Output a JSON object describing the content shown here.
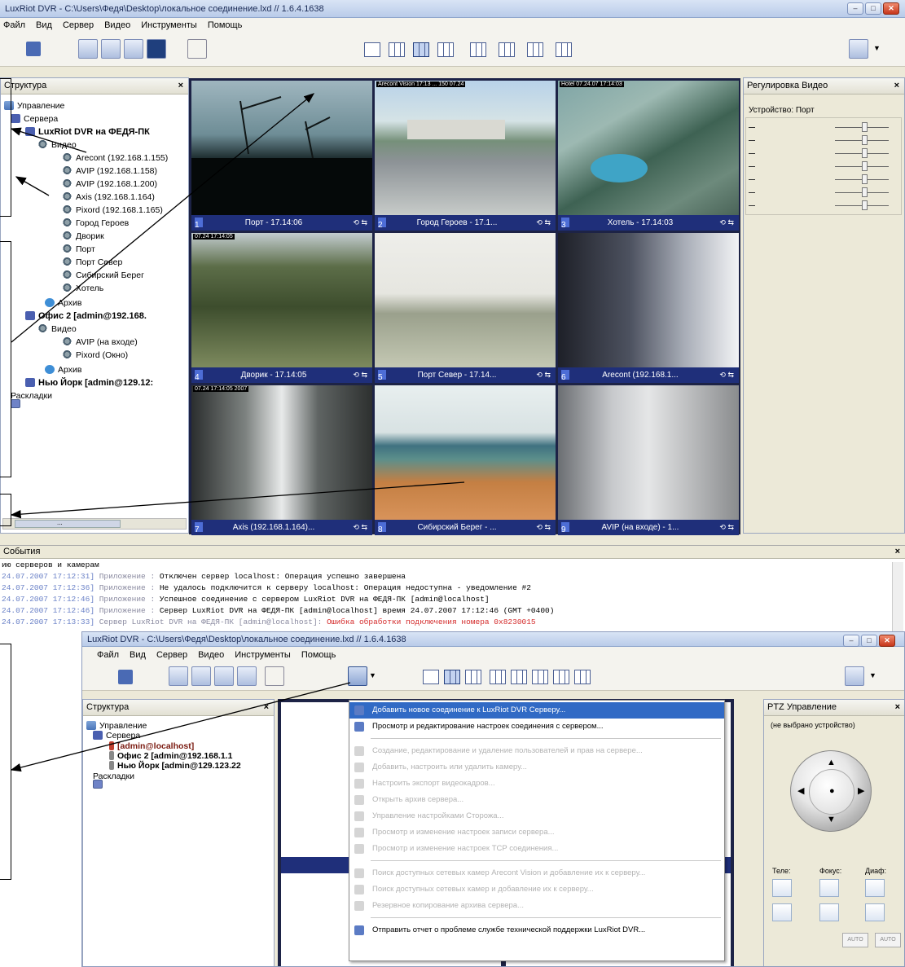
{
  "win1": {
    "title": "LuxRiot DVR - C:\\Users\\Федя\\Desktop\\локальное соединение.lxd // 1.6.4.1638",
    "menu": [
      "Файл",
      "Вид",
      "Сервер",
      "Видео",
      "Инструменты",
      "Помощь"
    ],
    "structure_panel": {
      "title": "Структура",
      "tree": [
        "Управление",
        "Сервера",
        "LuxRiot DVR на ФЕДЯ-ПК",
        "Видео",
        "Arecont (192.168.1.155)",
        "AVIP (192.168.1.158)",
        "AVIP (192.168.1.200)",
        "Axis (192.168.1.164)",
        "Pixord (192.168.1.165)",
        "Город Героев",
        "Дворик",
        "Порт",
        "Порт Север",
        "Сибирский Берег",
        "Хотель",
        "Архив",
        "Офис 2 [admin@192.168.",
        "Видео",
        "AVIP (на входе)",
        "Pixord (Окно)",
        "Архив",
        "Нью Йорк [admin@129.12:",
        "Раскладки"
      ],
      "scroll_label": "..."
    },
    "cameras": [
      {
        "num": "1",
        "label": "Порт - 17.14:06",
        "osd": ""
      },
      {
        "num": "2",
        "label": "Город Героев - 17.1...",
        "osd": "Arecont Vision 17:13 ... 150 07.24"
      },
      {
        "num": "3",
        "label": "Хотель - 17.14:03",
        "osd": "Hotel 07.24.07 17:14:03"
      },
      {
        "num": "4",
        "label": "Дворик - 17.14:05",
        "osd": "07.24 17:14:05"
      },
      {
        "num": "5",
        "label": "Порт Север - 17.14...",
        "osd": ""
      },
      {
        "num": "6",
        "label": "Arecont (192.168.1...",
        "osd": ""
      },
      {
        "num": "7",
        "label": "Axis (192.168.1.164)...",
        "osd": "07.24 17:14:05 2007"
      },
      {
        "num": "8",
        "label": "Сибирский Берег - ...",
        "osd": ""
      },
      {
        "num": "9",
        "label": "AVIP (на входе) - 1...",
        "osd": ""
      }
    ],
    "video_adjust": {
      "title": "Регулировка Видео",
      "device_label": "Устройство: Порт",
      "levels": [
        0.55,
        0.55,
        0.55,
        0.55,
        0.55,
        0.55,
        0.55
      ]
    },
    "events": {
      "title": "События",
      "lines": [
        {
          "date": "",
          "cat": "",
          "text": "ию серверов и камерам"
        },
        {
          "date": "24.07.2007 17:12:31]",
          "cat": " Приложение : ",
          "text": "Отключен сервер localhost: Операция успешно завершена"
        },
        {
          "date": "24.07.2007 17:12:36]",
          "cat": " Приложение : ",
          "text": "Не удалось подключится к серверу localhost: Операция недоступна - уведомление #2"
        },
        {
          "date": "24.07.2007 17:12:46]",
          "cat": " Приложение : ",
          "text": "Успешное соединение с сервером LuxRiot DVR на ФЕДЯ-ПК [admin@localhost]"
        },
        {
          "date": "24.07.2007 17:12:46]",
          "cat": " Приложение : ",
          "text": "Сервер LuxRiot DVR на ФЕДЯ-ПК [admin@localhost] время 24.07.2007 17:12:46 (GMT +0400)"
        },
        {
          "date": "24.07.2007 17:13:33]",
          "cat": " Сервер LuxRiot DVR на ФЕДЯ-ПК [admin@localhost]: ",
          "text": "Ошибка обработки подключения номера 0x8230015"
        }
      ]
    }
  },
  "win2": {
    "title": "LuxRiot DVR - C:\\Users\\Федя\\Desktop\\локальное соединение.lxd // 1.6.4.1638",
    "menu": [
      "Файл",
      "Вид",
      "Сервер",
      "Видео",
      "Инструменты",
      "Помощь"
    ],
    "structure_panel": {
      "title": "Структура",
      "tree": [
        "Управление",
        "Сервера",
        "[admin@localhost]",
        "Офис 2 [admin@192.168.1.1",
        "Нью Йорк [admin@129.123.22",
        "Раскладки"
      ]
    },
    "server_menu": [
      {
        "label": "Добавить новое соединение к LuxRiot DVR Серверу...",
        "enabled": true,
        "highlight": true
      },
      {
        "label": "Просмотр и редактирование настроек соединения с сервером...",
        "enabled": true,
        "highlight": false
      },
      {
        "label": "Создание, редактирование и удаление пользователей и прав на сервере...",
        "enabled": false,
        "highlight": false
      },
      {
        "label": "Добавить, настроить или удалить камеру...",
        "enabled": false,
        "highlight": false
      },
      {
        "label": "Настроить экспорт видеокадров...",
        "enabled": false,
        "highlight": false
      },
      {
        "label": "Открыть архив сервера...",
        "enabled": false,
        "highlight": false
      },
      {
        "label": "Управление настройками Сторожа...",
        "enabled": false,
        "highlight": false
      },
      {
        "label": "Просмотр и изменение настроек записи сервера...",
        "enabled": false,
        "highlight": false
      },
      {
        "label": "Просмотр и изменение настроек TCP соединения...",
        "enabled": false,
        "highlight": false
      },
      {
        "label": "Поиск доступных сетевых камер Arecont Vision и добавление их к серверу...",
        "enabled": false,
        "highlight": false
      },
      {
        "label": "Поиск доступных сетевых камер и добавление их к серверу...",
        "enabled": false,
        "highlight": false
      },
      {
        "label": "Резервное копирование архива сервера...",
        "enabled": false,
        "highlight": false
      },
      {
        "label": "Отправить отчет о проблеме службе технической поддержки LuxRiot DVR...",
        "enabled": true,
        "highlight": false
      }
    ],
    "ptz": {
      "title": "PTZ Управление",
      "device": "(не выбрано устройство)",
      "tele_label": "Теле:",
      "focus_label": "Фокус:",
      "iris_label": "Диаф:",
      "auto1": "AUTO",
      "auto2": "AUTO"
    }
  },
  "colors": {
    "caption_bar": "#1f2f7a",
    "grid_bg": "#1d2346",
    "menu_highlight": "#316ac5",
    "log_date": "#6a81c7",
    "log_error": "#d42a2a"
  }
}
